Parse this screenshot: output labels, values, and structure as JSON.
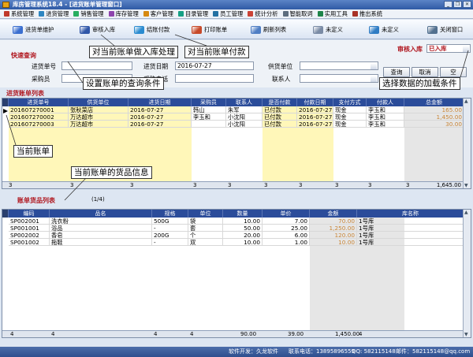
{
  "window": {
    "title": "库房管理系统18.4 - [进货账单管理窗口]"
  },
  "menu": [
    {
      "label": "系统管理",
      "color": "#c0392b"
    },
    {
      "label": "进货管理",
      "color": "#2e86c1"
    },
    {
      "label": "销售管理",
      "color": "#27ae60"
    },
    {
      "label": "库存管理",
      "color": "#8e44ad"
    },
    {
      "label": "客户管理",
      "color": "#d68910"
    },
    {
      "label": "目录管理",
      "color": "#16a085"
    },
    {
      "label": "员工管理",
      "color": "#2471a3"
    },
    {
      "label": "统计分析",
      "color": "#cb4335"
    },
    {
      "label": "智能取词",
      "color": "#5d6d7e"
    },
    {
      "label": "实用工具",
      "color": "#1e8449"
    },
    {
      "label": "推出系统",
      "color": "#a93226"
    }
  ],
  "toolbar": [
    {
      "label": "进货单维护",
      "icon": "edit-doc-icon",
      "color": "#3b6fd0"
    },
    {
      "label": "审核入库",
      "icon": "stamp-icon",
      "color": "#2f56a8"
    },
    {
      "label": "结账付款",
      "icon": "pay-icon",
      "color": "#2a8bd0"
    },
    {
      "label": "打印账单",
      "icon": "printer-icon",
      "color": "#c74a2a"
    },
    {
      "label": "刷新列表",
      "icon": "refresh-icon",
      "color": "#4f7ec4"
    },
    {
      "label": "未定义",
      "icon": "undefined-icon",
      "color": "#7a8ba5"
    },
    {
      "label": "未定义",
      "icon": "undefined-icon",
      "color": "#2f7cc4"
    },
    {
      "label": "关闭窗口",
      "icon": "close-window-icon",
      "color": "#52708f"
    }
  ],
  "filter": {
    "title": "快速查询",
    "audit_label": "审核入库",
    "audit_value": "已入库",
    "order_no_label": "进货单号",
    "date_label": "进货日期",
    "date_value": "2016-07-27",
    "supplier_label": "供货单位",
    "buyer_label": "采购员",
    "phone_label": "采购电话",
    "contact_label": "联系人",
    "query_button": "查询",
    "cancel_button": "取消",
    "third_button": "空"
  },
  "orders": {
    "title": "进货账单列表",
    "columns": [
      "进货单号",
      "供货单位",
      "进货日期",
      "采购员",
      "联系人",
      "是否付款",
      "付款日期",
      "支付方式",
      "付款人",
      "总金额"
    ],
    "rows": [
      [
        "201607270001",
        "张秋菜店",
        "2016-07-27",
        "韩山",
        "朱军",
        "已付款",
        "2016-07-27",
        "现金",
        "李玉和",
        "165.00"
      ],
      [
        "201607270002",
        "万达超市",
        "2016-07-27",
        "李玉和",
        "小沈阳",
        "已付款",
        "2016-07-27",
        "现金",
        "李玉和",
        "1,450.00"
      ],
      [
        "201607270003",
        "万达超市",
        "2016-07-27",
        "",
        "小沈阳",
        "已付款",
        "2016-07-27",
        "现金",
        "李玉和",
        "30.00"
      ]
    ],
    "footer_count": "3",
    "footer_values": [
      "3",
      "3",
      "3",
      "3",
      "3",
      "3",
      "3",
      "3",
      "3"
    ],
    "footer_total": "1,645.00"
  },
  "goods": {
    "title": "账单货品列表",
    "page": "(1/4)",
    "columns": [
      "编码",
      "品名",
      "规格",
      "单位",
      "数量",
      "单价",
      "金额",
      "库名称"
    ],
    "rows": [
      [
        "SP002001",
        "洗衣粉",
        "500G",
        "袋",
        "10.00",
        "7.00",
        "70.00",
        "1号库"
      ],
      [
        "SP001001",
        "浴品",
        "-",
        "套",
        "50.00",
        "25.00",
        "1,250.00",
        "1号库"
      ],
      [
        "SP002002",
        "香皂",
        "200G",
        "个",
        "20.00",
        "6.00",
        "120.00",
        "1号库"
      ],
      [
        "SP001002",
        "拖鞋",
        "-",
        "双",
        "10.00",
        "1.00",
        "10.00",
        "1号库"
      ]
    ],
    "footer": [
      "4",
      "4",
      "4",
      "4",
      "90.00",
      "39.00",
      "1,450.00",
      "4"
    ]
  },
  "callouts": {
    "audit": "对当前账单做入库处理",
    "pay": "对当前账单付款",
    "query": "设置账单的查询条件",
    "load": "选择数据的加载条件",
    "current": "当前账单",
    "goods": "当前账单的货品信息"
  },
  "status": {
    "developer": "软件开发：久龙软件",
    "phone": "联系电话：13895896559",
    "qq": "QQ: 582115148",
    "email": "邮件：582115148@qq.com"
  }
}
